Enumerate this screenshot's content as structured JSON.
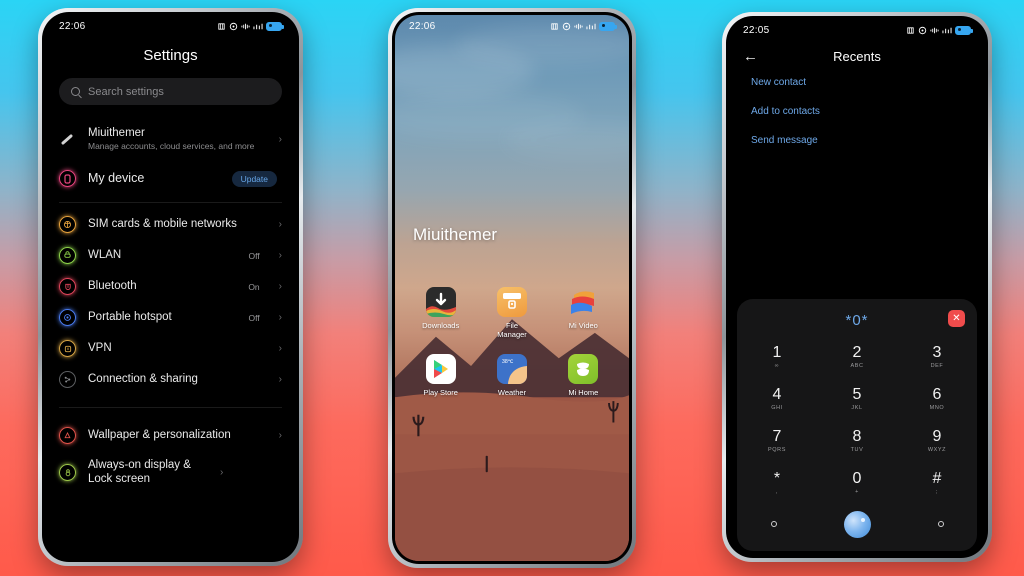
{
  "background": {
    "top_color": "#2ad4f5",
    "bottom_color": "#ff5a4a"
  },
  "phone_left": {
    "name": "settings-phone",
    "status": {
      "time": "22:06",
      "icons": [
        "bluetooth-icon",
        "alarm-icon",
        "vibrate-icon",
        "signal-icon",
        "battery-icon"
      ]
    },
    "title": "Settings",
    "search": {
      "placeholder": "Search settings",
      "icon": "search-icon"
    },
    "account": {
      "title": "Miuithemer",
      "subtitle": "Manage accounts, cloud services, and more",
      "icon": "account-icon",
      "chevron": "›"
    },
    "device": {
      "title": "My device",
      "badge": "Update",
      "icon": "device-icon",
      "color": "#e8457f"
    },
    "items": [
      {
        "label": "SIM cards & mobile networks",
        "value": "",
        "icon": "sim-card-icon",
        "glyph": "⊕",
        "color": "#e8a33d",
        "chevron": "›"
      },
      {
        "label": "WLAN",
        "value": "Off",
        "icon": "wifi-icon",
        "glyph": "▤",
        "color": "#8fd44a",
        "chevron": "›"
      },
      {
        "label": "Bluetooth",
        "value": "On",
        "icon": "bluetooth-icon",
        "glyph": "฿",
        "color": "#e0455a",
        "chevron": "›"
      },
      {
        "label": "Portable hotspot",
        "value": "Off",
        "icon": "hotspot-icon",
        "glyph": "◉",
        "color": "#4a7cf0",
        "chevron": "›"
      },
      {
        "label": "VPN",
        "value": "",
        "icon": "vpn-icon",
        "glyph": "□",
        "color": "#d6a445",
        "chevron": "›"
      },
      {
        "label": "Connection & sharing",
        "value": "",
        "icon": "connection-sharing-icon",
        "glyph": "⚯",
        "color": "#8b8d90",
        "chevron": "›"
      }
    ],
    "items2": [
      {
        "label": "Wallpaper & personalization",
        "value": "",
        "icon": "wallpaper-icon",
        "glyph": "◆",
        "color": "#e0534a",
        "chevron": "›"
      },
      {
        "label": "Always-on display & Lock screen",
        "value": "",
        "icon": "lock-screen-icon",
        "glyph": "Θ",
        "color": "#9ec74a",
        "chevron": "›"
      }
    ]
  },
  "phone_mid": {
    "name": "home-screen-phone",
    "status": {
      "time": "22:06"
    },
    "widget_title": "Miuithemer",
    "apps": [
      {
        "label": "Downloads",
        "icon": "downloads-icon"
      },
      {
        "label": "File\nManager",
        "label_line1": "File",
        "label_line2": "Manager",
        "icon": "file-manager-icon"
      },
      {
        "label": "Mi Video",
        "icon": "mi-video-icon"
      },
      {
        "label": "Play Store",
        "icon": "play-store-icon"
      },
      {
        "label": "Weather",
        "icon": "weather-icon",
        "temp": "38℃"
      },
      {
        "label": "Mi Home",
        "icon": "mi-home-icon"
      }
    ]
  },
  "phone_right": {
    "name": "recents-dialer-phone",
    "status": {
      "time": "22:05"
    },
    "back_icon": "back-arrow-icon",
    "title": "Recents",
    "links": [
      "New contact",
      "Add to contacts",
      "Send message"
    ],
    "dialer": {
      "number": "*0*",
      "close_icon": "close-icon",
      "keys": [
        {
          "digit": "1",
          "letters": "∞"
        },
        {
          "digit": "2",
          "letters": "ABC"
        },
        {
          "digit": "3",
          "letters": "DEF"
        },
        {
          "digit": "4",
          "letters": "GHI"
        },
        {
          "digit": "5",
          "letters": "JKL"
        },
        {
          "digit": "6",
          "letters": "MNO"
        },
        {
          "digit": "7",
          "letters": "PQRS"
        },
        {
          "digit": "8",
          "letters": "TUV"
        },
        {
          "digit": "9",
          "letters": "WXYZ"
        },
        {
          "digit": "*",
          "letters": ","
        },
        {
          "digit": "0",
          "letters": "+"
        },
        {
          "digit": "#",
          "letters": ";"
        }
      ],
      "left_action_icon": "more-options-icon",
      "call_icon": "call-button-icon",
      "right_action_icon": "keypad-hide-icon"
    }
  }
}
